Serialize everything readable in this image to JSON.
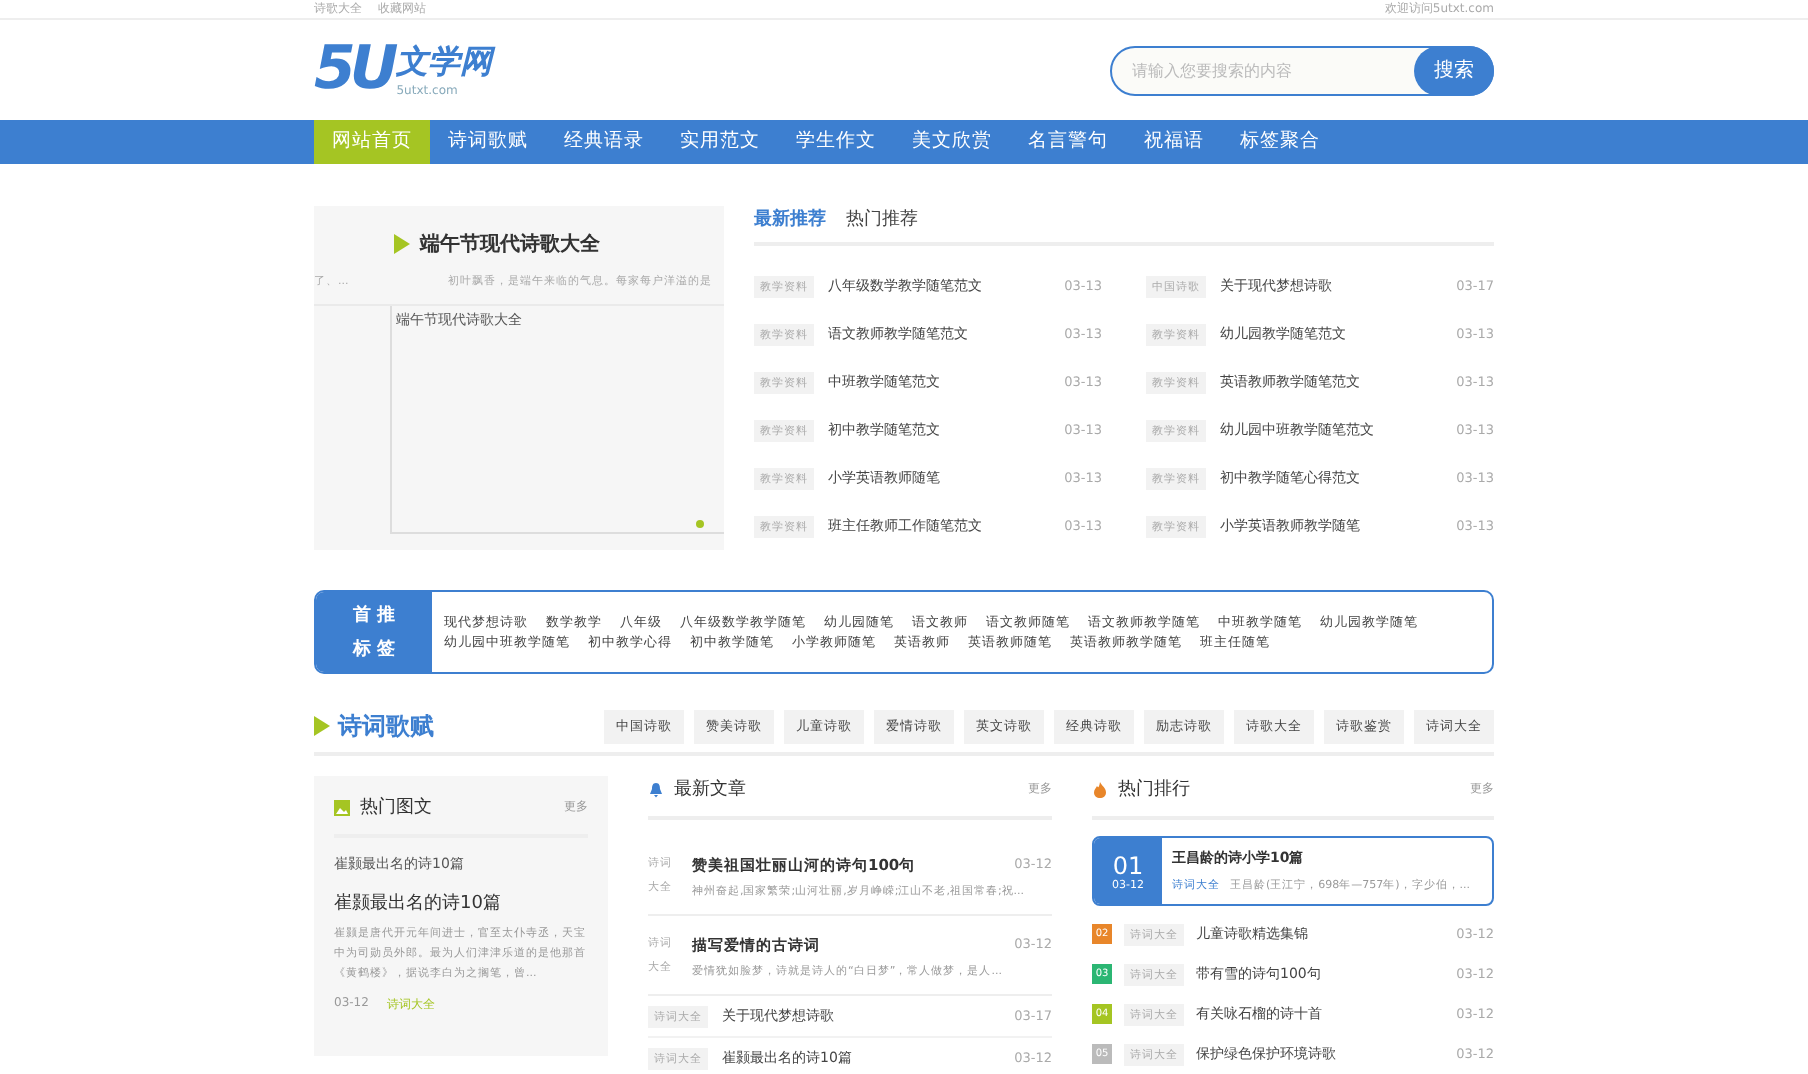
{
  "top_bar": {
    "links": [
      "诗歌大全",
      "收藏网站"
    ],
    "welcome": "欢迎访问5utxt.com"
  },
  "logo": {
    "mark": "5U",
    "name": "文学网",
    "domain": "5utxt.com"
  },
  "search": {
    "placeholder": "请输入您要搜索的内容",
    "button": "搜索"
  },
  "nav": [
    {
      "label": "网站首页",
      "selected": true
    },
    {
      "label": "诗词歌赋",
      "selected": false
    },
    {
      "label": "经典语录",
      "selected": false
    },
    {
      "label": "实用范文",
      "selected": false
    },
    {
      "label": "学生作文",
      "selected": false
    },
    {
      "label": "美文欣赏",
      "selected": false
    },
    {
      "label": "名言警句",
      "selected": false
    },
    {
      "label": "祝福语",
      "selected": false
    },
    {
      "label": "标签聚合",
      "selected": false
    }
  ],
  "feature": {
    "title": "端午节现代诗歌大全",
    "prev_snippet": "了、...",
    "snippet": "初叶飘香，是端午来临的气息。每家每户洋溢的是",
    "image_alt": "端午节现代诗歌大全"
  },
  "list_tabs": [
    {
      "label": "最新推荐",
      "selected": true
    },
    {
      "label": "热门推荐",
      "selected": false
    }
  ],
  "list": [
    {
      "tag": "教学资料",
      "title": "八年级数学教学随笔范文",
      "date": "03-13"
    },
    {
      "tag": "中国诗歌",
      "title": "关于现代梦想诗歌",
      "date": "03-17"
    },
    {
      "tag": "教学资料",
      "title": "语文教师教学随笔范文",
      "date": "03-13"
    },
    {
      "tag": "教学资料",
      "title": "幼儿园教学随笔范文",
      "date": "03-13"
    },
    {
      "tag": "教学资料",
      "title": "中班教学随笔范文",
      "date": "03-13"
    },
    {
      "tag": "教学资料",
      "title": "英语教师教学随笔范文",
      "date": "03-13"
    },
    {
      "tag": "教学资料",
      "title": "初中教学随笔范文",
      "date": "03-13"
    },
    {
      "tag": "教学资料",
      "title": "幼儿园中班教学随笔范文",
      "date": "03-13"
    },
    {
      "tag": "教学资料",
      "title": "小学英语教师随笔",
      "date": "03-13"
    },
    {
      "tag": "教学资料",
      "title": "初中教学随笔心得范文",
      "date": "03-13"
    },
    {
      "tag": "教学资料",
      "title": "班主任教师工作随笔范文",
      "date": "03-13"
    },
    {
      "tag": "教学资料",
      "title": "小学英语教师教学随笔",
      "date": "03-13"
    }
  ],
  "tags": {
    "label": [
      "首 推",
      "标 签"
    ],
    "items": [
      "现代梦想诗歌",
      "数学教学",
      "八年级",
      "八年级数学教学随笔",
      "幼儿园随笔",
      "语文教师",
      "语文教师随笔",
      "语文教师教学随笔",
      "中班教学随笔",
      "幼儿园教学随笔",
      "幼儿园中班教学随笔",
      "初中教学心得",
      "初中教学随笔",
      "小学教师随笔",
      "英语教师",
      "英语教师随笔",
      "英语教师教学随笔",
      "班主任随笔"
    ]
  },
  "section": {
    "title": "诗词歌赋",
    "chips": [
      "中国诗歌",
      "赞美诗歌",
      "儿童诗歌",
      "爱情诗歌",
      "英文诗歌",
      "经典诗歌",
      "励志诗歌",
      "诗歌大全",
      "诗歌鉴赏",
      "诗词大全"
    ]
  },
  "pic_column": {
    "title": "热门图文",
    "more": "更多",
    "image_alt": "崔颢最出名的诗10篇",
    "headline": "崔颢最出名的诗10篇",
    "summary": "崔颢是唐代开元年间进士，官至太仆寺丞，天宝中为司勋员外郎。最为人们津津乐道的是他那首《黄鹤楼》，据说李白为之搁笔，曾...",
    "date": "03-12",
    "category": "诗词大全"
  },
  "news_column": {
    "title": "最新文章",
    "more": "更多",
    "items": [
      {
        "kind": "rich",
        "tag": [
          "诗词",
          "大全"
        ],
        "title": "赞美祖国壮丽山河的诗句100句",
        "date": "03-12",
        "summary": "神州奋起,国家繁荣;山河壮丽,岁月峥嵘;江山不老,祖国常春;祝..."
      },
      {
        "kind": "rich",
        "tag": [
          "诗词",
          "大全"
        ],
        "title": "描写爱情的古诗词",
        "date": "03-12",
        "summary": "爱情犹如脸梦，诗就是诗人的“白日梦”，常人做梦，是人..."
      },
      {
        "kind": "plain",
        "tag": [
          "诗词大全"
        ],
        "title": "关于现代梦想诗歌",
        "date": "03-17"
      },
      {
        "kind": "plain",
        "tag": [
          "诗词大全"
        ],
        "title": "崔颢最出名的诗10篇",
        "date": "03-12"
      }
    ]
  },
  "rank_column": {
    "title": "热门排行",
    "more": "更多",
    "top": {
      "rank": "01",
      "date": "03-12",
      "title": "王昌龄的诗小学10篇",
      "category": "诗词大全",
      "summary": "王昌龄(王江宁，698年—757年)，字少伯，..."
    },
    "items": [
      {
        "rank": "02",
        "color": "#e8862a",
        "tag": "诗词大全",
        "title": "儿童诗歌精选集锦",
        "date": "03-12"
      },
      {
        "rank": "03",
        "color": "#2bb673",
        "tag": "诗词大全",
        "title": "带有雪的诗句100句",
        "date": "03-12"
      },
      {
        "rank": "04",
        "color": "#a5c523",
        "tag": "诗词大全",
        "title": "有关咏石榴的诗十首",
        "date": "03-12"
      },
      {
        "rank": "05",
        "color": "#bbbbbb",
        "tag": "诗词大全",
        "title": "保护绿色保护环境诗歌",
        "date": "03-12"
      }
    ]
  }
}
